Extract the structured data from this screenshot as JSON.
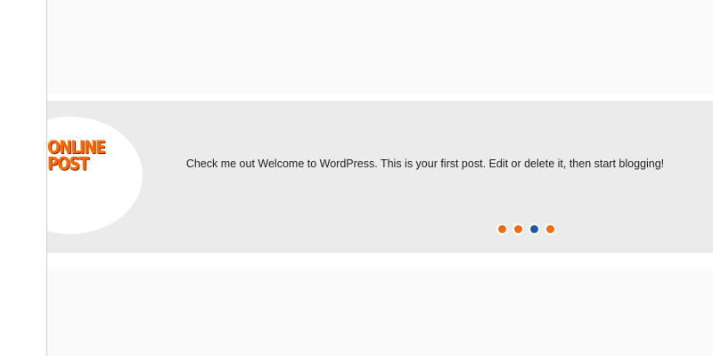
{
  "logo": {
    "line1": "ONLINE",
    "line2": "POST"
  },
  "slider": {
    "text": "Check me out Welcome to WordPress. This is your first post. Edit or delete it, then start blogging!",
    "dots": [
      {
        "state": "inactive",
        "color": "#f26b10"
      },
      {
        "state": "inactive",
        "color": "#f26b10"
      },
      {
        "state": "active",
        "color": "#1b5aa6"
      },
      {
        "state": "inactive",
        "color": "#f26b10"
      }
    ]
  },
  "colors": {
    "accent_orange": "#f26b10",
    "active_blue": "#1b5aa6",
    "band_gray": "#ebebeb"
  }
}
